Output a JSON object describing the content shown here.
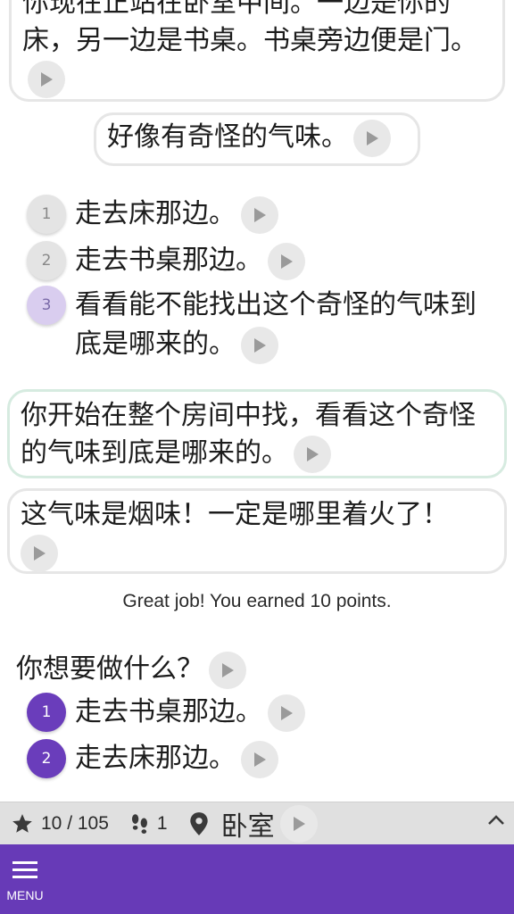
{
  "story": [
    {
      "text": "你现在正站在卧室中间。一边是你的床，另一边是书桌。书桌旁边便是门。"
    },
    {
      "text": "好像有奇怪的气味。"
    }
  ],
  "past_choices": [
    {
      "number": "1",
      "text": "走去床那边。"
    },
    {
      "number": "2",
      "text": "走去书桌那边。"
    },
    {
      "number": "3",
      "text": "看看能不能找出这个奇怪的气味到底是哪来的。"
    }
  ],
  "results": [
    {
      "text": "你开始在整个房间中找，看看这个奇怪的气味到底是哪来的。"
    },
    {
      "text": "这气味是烟味！一定是哪里着火了！"
    }
  ],
  "points_message": "Great job! You earned 10 points.",
  "question": "你想要做什么？",
  "choices": [
    {
      "number": "1",
      "text": "走去书桌那边。"
    },
    {
      "number": "2",
      "text": "走去床那边。"
    }
  ],
  "status": {
    "progress": "10 / 105",
    "steps": "1",
    "location": "卧室"
  },
  "bottom_bar": {
    "menu_label": "MENU"
  },
  "colors": {
    "accent": "#673ab7",
    "selected_choice": "#d9cdef",
    "result_border": "#d6ebe0"
  },
  "icons": [
    "play-icon",
    "star-icon",
    "footprints-icon",
    "location-pin-icon",
    "chevron-up-icon",
    "hamburger-menu-icon"
  ]
}
